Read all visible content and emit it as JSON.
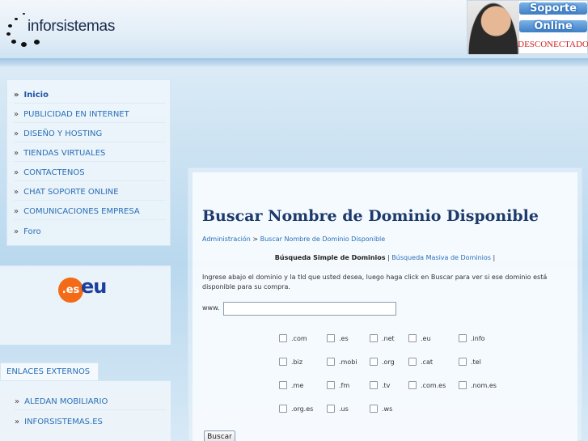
{
  "header": {
    "logo_text": "inforsistemas",
    "support": {
      "line1": "Soporte",
      "line2": "Online",
      "status": "DESCONECTADO"
    }
  },
  "menu": {
    "items": [
      {
        "label": "Inicio",
        "active": true
      },
      {
        "label": "PUBLICIDAD EN INTERNET"
      },
      {
        "label": "DISEÑO Y HOSTING"
      },
      {
        "label": "TIENDAS VIRTUALES"
      },
      {
        "label": "CONTACTENOS"
      },
      {
        "label": "CHAT SOPORTE ONLINE"
      },
      {
        "label": "COMUNICACIONES EMPRESA"
      },
      {
        "label": "Foro"
      }
    ]
  },
  "banner": {
    "es": ".es",
    "eu": "eu"
  },
  "external": {
    "title": "ENLACES EXTERNOS",
    "items": [
      {
        "label": "ALEDAN MOBILIARIO"
      },
      {
        "label": "INFORSISTEMAS.ES"
      }
    ]
  },
  "main": {
    "title": "Buscar Nombre de Dominio Disponible",
    "breadcrumb": {
      "root": "Administración",
      "sep": ">",
      "current": "Buscar Nombre de Dominio Disponible"
    },
    "tabs": {
      "simple": "Búsqueda Simple de Dominios",
      "sep1": "|",
      "massive": "Búsqueda Masiva de Dominios",
      "sep2": "|"
    },
    "instructions": "Ingrese abajo el dominio y la tld que usted desea, luego haga click en Buscar para ver si ese dominio está disponible para su compra.",
    "www_label": "www.",
    "domain_value": "",
    "tlds": [
      ".com",
      ".es",
      ".net",
      ".eu",
      ".info",
      ".biz",
      ".mobi",
      ".org",
      ".cat",
      ".tel",
      ".me",
      ".fm",
      ".tv",
      ".com.es",
      ".nom.es",
      ".org.es",
      ".us",
      ".ws"
    ],
    "search_button": "Buscar"
  }
}
